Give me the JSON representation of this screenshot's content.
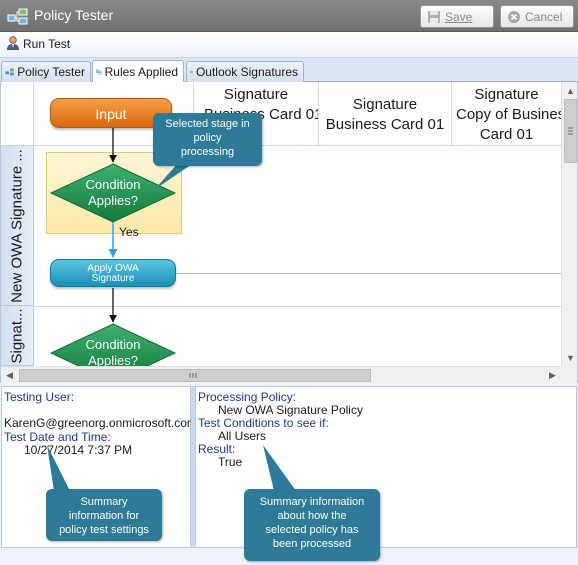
{
  "window": {
    "title": "Policy Tester",
    "save_label": "Save",
    "cancel_label": "Cancel"
  },
  "toolbar": {
    "run_test_label": "Run Test"
  },
  "tabs": [
    {
      "label": "Policy Tester",
      "active": false
    },
    {
      "label": "Rules Applied",
      "active": true
    },
    {
      "label": "Outlook Signatures",
      "active": false
    }
  ],
  "grid": {
    "columns": [
      {
        "line1": "Signature",
        "line2": "Business Card 01",
        "line3": ")"
      },
      {
        "line1": "Signature",
        "line2": "Business Card 01"
      },
      {
        "line1": "Signature",
        "line2": "Copy of Business",
        "line3": "Card 01"
      }
    ],
    "rows": [
      {
        "label": "New OWA Signature ..."
      },
      {
        "label": "Signat..."
      }
    ]
  },
  "flow": {
    "input_label": "Input",
    "condition_line1": "Condition",
    "condition_line2": "Applies?",
    "yes_label": "Yes",
    "apply_line1": "Apply OWA",
    "apply_line2": "Signature"
  },
  "callouts": {
    "selected_stage": [
      "Selected stage in",
      "policy",
      "processing"
    ],
    "summary_settings": [
      "Summary",
      "information for",
      "policy test settings"
    ],
    "summary_policy": [
      "Summary information",
      "about how the",
      "selected policy has",
      "been processed"
    ]
  },
  "test_settings": {
    "testing_user_label": "Testing User:",
    "testing_user": "KarenG@greenorg.onmicrosoft.com",
    "test_date_label": "Test Date and Time:",
    "test_date": "10/27/2014 7:37 PM"
  },
  "processing": {
    "policy_label": "Processing Policy:",
    "policy": "New OWA Signature Policy",
    "conditions_label": "Test Conditions to see if:",
    "conditions": "All Users",
    "result_label": "Result:",
    "result": "True"
  },
  "colors": {
    "callout": "#2d7a99",
    "input_orange": "#e07a1f",
    "condition_green": "#1f8a4c",
    "apply_blue": "#1a8fb8",
    "selected_yellow": "#fde9a8"
  }
}
